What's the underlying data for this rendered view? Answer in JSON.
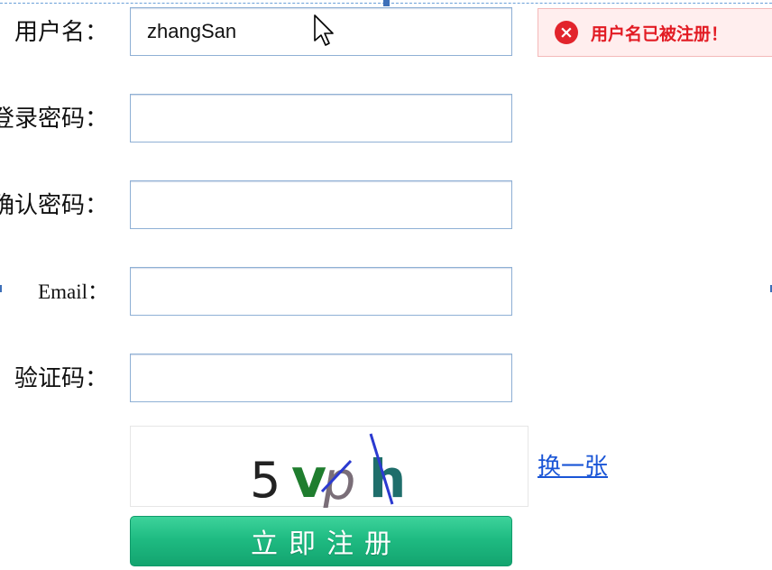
{
  "form": {
    "username": {
      "label": "用户名：",
      "value": "zhangSan",
      "error": "用户名已被注册！"
    },
    "password": {
      "label": "登录密码："
    },
    "confirm_password": {
      "label": "确认密码："
    },
    "email": {
      "label": "Email："
    },
    "captcha": {
      "label": "验证码：",
      "chars": [
        "5",
        "v",
        "p",
        "h"
      ],
      "refresh_label": "换一张"
    },
    "submit_label": "立即注册"
  },
  "icons": {
    "error": "close-circle-icon",
    "cursor": "mouse-cursor-icon"
  },
  "colors": {
    "error_text": "#e21b23",
    "error_bg": "#ffeeee",
    "field_border": "#8fb0d5",
    "button_green": "#1fbb82",
    "link_blue": "#1a55d6",
    "captcha_5": "#222222",
    "captcha_v": "#1f7d2e",
    "captcha_p": "#7a6e78",
    "captcha_h": "#1f6e6b",
    "captcha_line": "#2b3ad0"
  }
}
